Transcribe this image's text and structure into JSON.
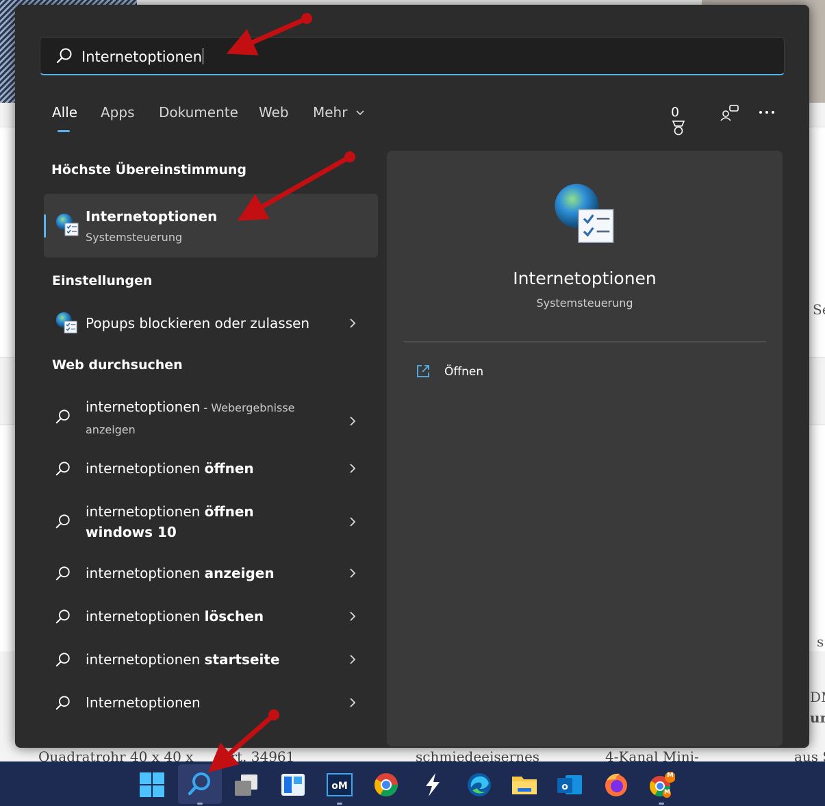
{
  "background_page": {
    "strip_items": [
      "Quadratrohr 40 x 40 x",
      "Art. 34961",
      "schmiedeeisernes",
      "4-Kanal Mini-",
      "aus S"
    ],
    "edge_texts": [
      "Se",
      "s",
      "DM",
      "ur"
    ]
  },
  "search": {
    "query": "Internetoptionen"
  },
  "tabs": [
    {
      "label": "Alle",
      "active": true
    },
    {
      "label": "Apps"
    },
    {
      "label": "Dokumente"
    },
    {
      "label": "Web"
    },
    {
      "label": "Mehr"
    }
  ],
  "top_right": {
    "points": "0",
    "icons": [
      "rewards-icon",
      "account-switch-icon",
      "more-icon"
    ]
  },
  "best_match": {
    "heading": "Höchste Übereinstimmung",
    "title": "Internetoptionen",
    "subtitle": "Systemsteuerung",
    "icon": "internet-options-icon"
  },
  "settings": {
    "heading": "Einstellungen",
    "items": [
      {
        "label": "Popups blockieren oder zulassen",
        "icon": "internet-options-icon"
      }
    ]
  },
  "web": {
    "heading": "Web durchsuchen",
    "items": [
      {
        "prefix": "internetoptionen",
        "suffix": "",
        "hint": " - Webergebnisse anzeigen"
      },
      {
        "prefix": "internetoptionen ",
        "suffix": "öffnen",
        "hint": ""
      },
      {
        "prefix": "internetoptionen ",
        "suffix": "öffnen windows 10",
        "hint": ""
      },
      {
        "prefix": "internetoptionen ",
        "suffix": "anzeigen",
        "hint": ""
      },
      {
        "prefix": "internetoptionen ",
        "suffix": "löschen",
        "hint": ""
      },
      {
        "prefix": "internetoptionen ",
        "suffix": "startseite",
        "hint": ""
      },
      {
        "prefix": "Internetoptionen",
        "suffix": "",
        "hint": ""
      }
    ]
  },
  "preview": {
    "title": "Internetoptionen",
    "subtitle": "Systemsteuerung",
    "action_label": "Öffnen",
    "action_icon": "open-external-icon"
  },
  "taskbar": {
    "apps": [
      "start-icon",
      "search-icon",
      "task-view-icon",
      "widgets-icon",
      "outlook-mail-om-icon",
      "chrome-icon",
      "stack-app-icon",
      "edge-icon",
      "file-explorer-icon",
      "outlook-icon",
      "firefox-icon",
      "chrome-profile-icon"
    ],
    "badge_text": "M",
    "colors": {
      "bar": "#1d2a52",
      "accent": "#58b3ea"
    }
  }
}
